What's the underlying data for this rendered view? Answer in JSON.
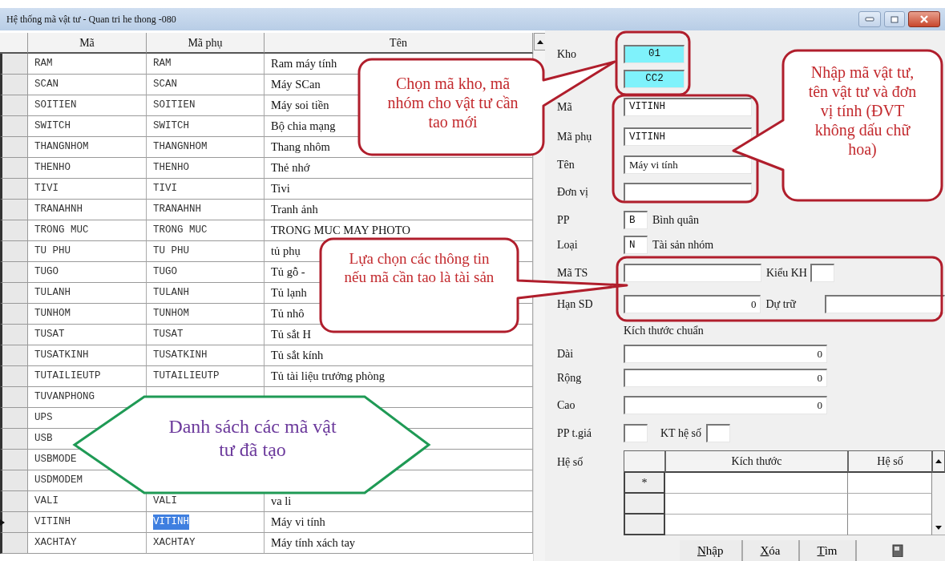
{
  "window": {
    "title": "Hệ thống mã vật tư - Quan tri he thong -080"
  },
  "item_table": {
    "columns": [
      "Mã",
      "Mã phụ",
      "Tên"
    ],
    "rows": [
      {
        "code": "RAM",
        "sub_code": "RAM",
        "name": "Ram máy tính",
        "selected": false
      },
      {
        "code": "SCAN",
        "sub_code": "SCAN",
        "name": "Máy SCan",
        "selected": false
      },
      {
        "code": "SOITIEN",
        "sub_code": "SOITIEN",
        "name": "Máy soi tiền",
        "selected": false
      },
      {
        "code": "SWITCH",
        "sub_code": "SWITCH",
        "name": "Bộ chia mạng",
        "selected": false
      },
      {
        "code": "THANGNHOM",
        "sub_code": "THANGNHOM",
        "name": "Thang nhôm",
        "selected": false
      },
      {
        "code": "THENHO",
        "sub_code": "THENHO",
        "name": "Thẻ nhớ",
        "selected": false
      },
      {
        "code": "TIVI",
        "sub_code": "TIVI",
        "name": "Tivi",
        "selected": false
      },
      {
        "code": "TRANAHNH",
        "sub_code": "TRANAHNH",
        "name": "Tranh ảnh",
        "selected": false
      },
      {
        "code": "TRONG MUC",
        "sub_code": "TRONG MUC",
        "name": "TRONG MUC MAY PHOTO",
        "selected": false
      },
      {
        "code": "TU PHU",
        "sub_code": "TU PHU",
        "name": "tủ phụ",
        "selected": false
      },
      {
        "code": "TUGO",
        "sub_code": "TUGO",
        "name": "Tủ gỗ -",
        "selected": false
      },
      {
        "code": "TULANH",
        "sub_code": "TULANH",
        "name": "Tủ lạnh",
        "selected": false
      },
      {
        "code": "TUNHOM",
        "sub_code": "TUNHOM",
        "name": "Tủ nhô",
        "selected": false
      },
      {
        "code": "TUSAT",
        "sub_code": "TUSAT",
        "name": "Tủ sắt H",
        "selected": false
      },
      {
        "code": "TUSATKINH",
        "sub_code": "TUSATKINH",
        "name": "Tủ sắt kính",
        "selected": false
      },
      {
        "code": "TUTAILIEUTP",
        "sub_code": "TUTAILIEUTP",
        "name": "Tủ tài liệu trưởng phòng",
        "selected": false
      },
      {
        "code": "TUVANPHONG",
        "selected": false
      },
      {
        "code": "UPS",
        "selected": false
      },
      {
        "code": "USB",
        "selected": false
      },
      {
        "code": "USBMODE",
        "selected": false
      },
      {
        "code": "USDMODEM",
        "selected": false
      },
      {
        "code": "VALI",
        "sub_code": "VALI",
        "name": "va li",
        "selected": false
      },
      {
        "code": "VITINH",
        "sub_code": "VITINH",
        "name": "Máy vi tính",
        "selected": true
      },
      {
        "code": "XACHTAY",
        "sub_code": "XACHTAY",
        "name": "Máy tính xách tay",
        "selected": false
      }
    ]
  },
  "form": {
    "rows": [
      {
        "kind": "short",
        "label": "Kho",
        "value": "01",
        "highlighted": true
      },
      {
        "kind": "short",
        "value": "CC2",
        "highlighted": true
      },
      {
        "kind": "text",
        "label": "Mã",
        "value": "VITINH",
        "highlighted": false
      },
      {
        "kind": "text",
        "label": "Mã phụ",
        "value": "VITINH",
        "highlighted": false
      },
      {
        "kind": "text",
        "label": "Tên",
        "value": "Máy vi tính",
        "highlighted": false
      },
      {
        "kind": "text",
        "label": "Đơn vị",
        "highlighted": false
      },
      {
        "kind": "code",
        "label": "PP",
        "value": "B",
        "description": "Bình quân"
      },
      {
        "kind": "code",
        "label": "Loại",
        "value": "N",
        "description": "Tài sản nhóm"
      },
      {
        "kind": "pair_small",
        "label": "Mã TS",
        "label2": "Kiểu KH"
      },
      {
        "kind": "pair_wide",
        "label": "Hạn SD",
        "value": "0",
        "label2": "Dự trữ"
      },
      {
        "kind": "heading",
        "label": "Kích thước chuẩn"
      },
      {
        "kind": "number",
        "label": "Dài",
        "value": "0"
      },
      {
        "kind": "number",
        "label": "Rộng",
        "value": "0"
      },
      {
        "kind": "number",
        "label": "Cao",
        "value": "0"
      },
      {
        "kind": "pair_tiny",
        "label": "PP t.giá",
        "label2": "KT hệ số"
      }
    ],
    "factor_grid": {
      "label": "Hệ số",
      "columns": [
        "Kích thước",
        "Hệ số"
      ],
      "rows": [
        {
          "kind": "new",
          "indicator": "*"
        },
        {
          "kind": "blank"
        },
        {
          "kind": "blank"
        }
      ]
    },
    "buttons": [
      {
        "label": "Nhập",
        "underline_first": true
      },
      {
        "label": "Xóa",
        "underline_first": true
      },
      {
        "label": "Tìm",
        "underline_first": true
      }
    ]
  },
  "callouts": [
    {
      "kind": "bubble",
      "text": "Chọn mã kho, mã nhóm cho vật tư cần tao mới"
    },
    {
      "kind": "bubble",
      "text": "Nhập mã vật tư, tên vật tư và đơn vị tính (ĐVT không dấu chữ hoa)"
    },
    {
      "kind": "bubble",
      "text": "Lựa chọn các thông tin nếu mã cần tao là tài sản"
    },
    {
      "kind": "hexagon",
      "text": "Danh sách các mã vật tư đã tạo"
    }
  ]
}
